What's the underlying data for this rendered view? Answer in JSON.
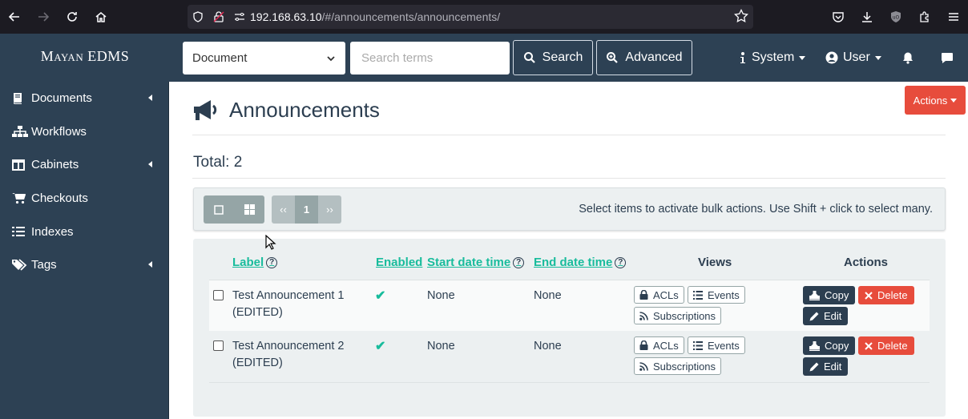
{
  "browser": {
    "url_host": "192.168.63.10",
    "url_path": "/#/announcements/announcements/"
  },
  "header": {
    "brand": "Mayan EDMS",
    "search_scope": "Document",
    "search_placeholder": "Search terms",
    "search_label": "Search",
    "advanced_label": "Advanced",
    "system_label": "System",
    "user_label": "User"
  },
  "sidebar": {
    "items": [
      {
        "label": "Documents",
        "icon": "book-icon",
        "submenu": true
      },
      {
        "label": "Workflows",
        "icon": "sitemap-icon",
        "submenu": false
      },
      {
        "label": "Cabinets",
        "icon": "columns-icon",
        "submenu": true
      },
      {
        "label": "Checkouts",
        "icon": "cart-icon",
        "submenu": false
      },
      {
        "label": "Indexes",
        "icon": "list-icon",
        "submenu": false
      },
      {
        "label": "Tags",
        "icon": "tags-icon",
        "submenu": true
      }
    ]
  },
  "main": {
    "actions_label": "Actions",
    "title": "Announcements",
    "total": "Total: 2",
    "pager": {
      "prev": "‹‹",
      "current": "1",
      "next": "››"
    },
    "bulk_hint": "Select items to activate bulk actions. Use Shift + click to select many.",
    "columns": {
      "label": "Label",
      "enabled": "Enabled",
      "start": "Start date time",
      "end": "End date time",
      "views": "Views",
      "actions": "Actions"
    },
    "view_buttons": {
      "acls": "ACLs",
      "events": "Events",
      "subscriptions": "Subscriptions"
    },
    "action_buttons": {
      "copy": "Copy",
      "delete": "Delete",
      "edit": "Edit"
    },
    "rows": [
      {
        "label_line1": "Test Announcement 1",
        "label_line2": "(EDITED)",
        "enabled": "✔",
        "start": "None",
        "end": "None"
      },
      {
        "label_line1": "Test Announcement 2",
        "label_line2": "(EDITED)",
        "enabled": "✔",
        "start": "None",
        "end": "None"
      }
    ]
  },
  "colors": {
    "navbar": "#2d4154",
    "accent": "#18bc9c",
    "danger": "#e74c3c",
    "primary": "#2c3e50"
  }
}
